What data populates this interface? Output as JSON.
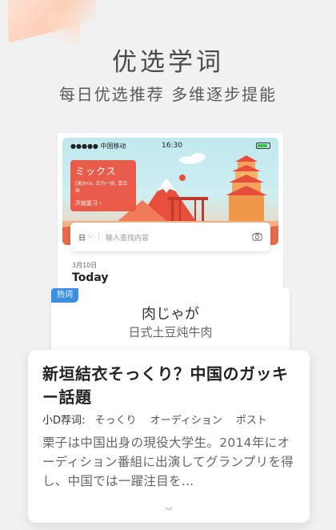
{
  "header": {
    "title": "优选学词",
    "subtitle": "每日优选推荐  多维逐步提能"
  },
  "phone_preview": {
    "status": {
      "carrier": "●●●●● 中国移动",
      "time": "16:30"
    },
    "banner": {
      "title": "ミックス",
      "desc": "[寅]mix, 合为一体, 混合体",
      "button": "开始复习 ›"
    },
    "search": {
      "lang": "日",
      "chevron": "⌵",
      "placeholder": "输入查找内容"
    },
    "date": "3月10日",
    "today": "Today"
  },
  "word_card": {
    "badge": "热词",
    "word": "肉じゃが",
    "meaning": "日式土豆炖牛肉"
  },
  "news_card": {
    "title": "新垣結衣そっくり？中国のガッキー話題",
    "tags_label": "小D荐词:",
    "tags": [
      "そっくり",
      "オーディション",
      "ポスト"
    ],
    "body": "栗子は中国出身の現役大学生。2014年にオーディション番組に出演してグランプリを得し、中国では一躍注目を…",
    "more": "︾"
  },
  "colors": {
    "accent_red": "#e84e3c",
    "badge_blue": "#3b8fe0"
  }
}
